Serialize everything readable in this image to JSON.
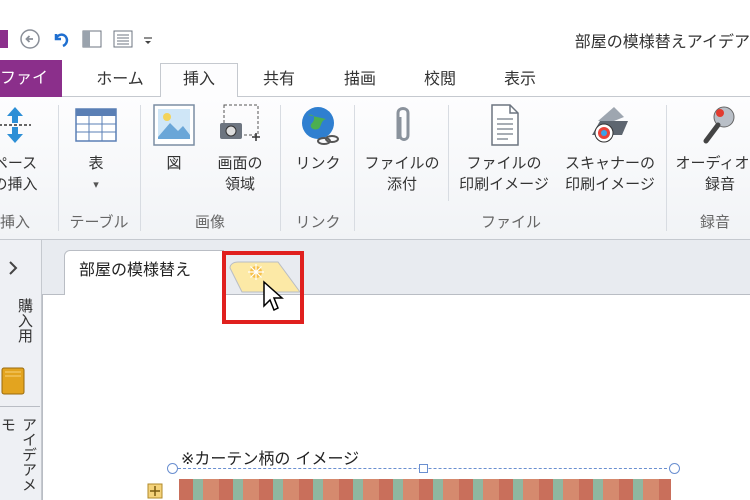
{
  "window": {
    "title": "部屋の模様替えアイデア"
  },
  "ribbon_tabs": [
    {
      "label": "ファイル"
    },
    {
      "label": "ホーム"
    },
    {
      "label": "挿入"
    },
    {
      "label": "共有"
    },
    {
      "label": "描画"
    },
    {
      "label": "校閲"
    },
    {
      "label": "表示"
    }
  ],
  "ribbon": {
    "buttons": {
      "space": {
        "line1": "ペース",
        "line2": "の挿入"
      },
      "table": {
        "line1": "表",
        "line2": "▾"
      },
      "picture": {
        "line1": "図"
      },
      "screen_clip": {
        "line1": "画面の",
        "line2": "領域"
      },
      "link": {
        "line1": "リンク"
      },
      "attach_file": {
        "line1": "ファイルの",
        "line2": "添付"
      },
      "file_printout": {
        "line1": "ファイルの",
        "line2": "印刷イメージ"
      },
      "scanner_printout": {
        "line1": "スキャナーの",
        "line2": "印刷イメージ"
      },
      "audio": {
        "line1": "オーディオの",
        "line2": "録音"
      }
    },
    "groups": {
      "insert": "挿入",
      "tables": "テーブル",
      "images": "画像",
      "links": "リンク",
      "files": "ファイル",
      "recording": "録音"
    }
  },
  "notebook": {
    "section_tab": "部屋の模様替え",
    "left_pane": {
      "label1": "購入用",
      "label2": "アイデアメモ"
    }
  },
  "page": {
    "text": "※カーテン柄の イメージ"
  },
  "colors": {
    "file_tab": "#8b2f8b",
    "highlight": "#e0201e",
    "new_tab": "#fce9a6"
  }
}
